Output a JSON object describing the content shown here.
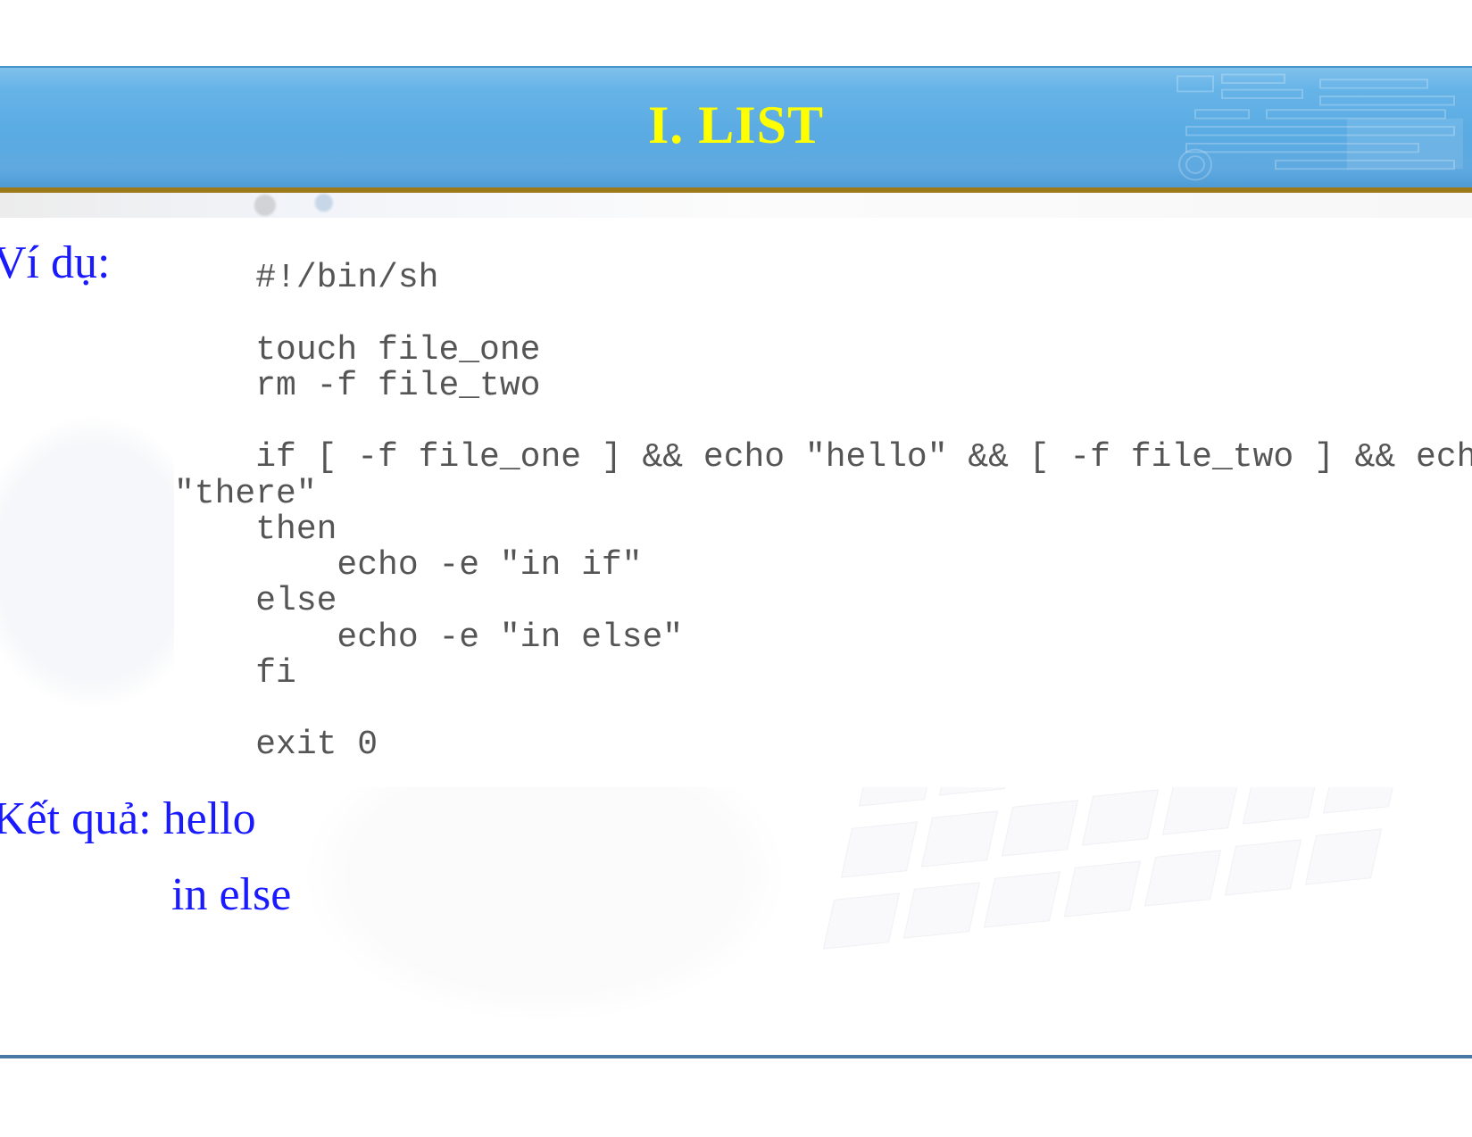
{
  "header": {
    "title": "I. LIST"
  },
  "labels": {
    "example": "Ví dụ:",
    "result_prefix": "Kết quả:",
    "result_line1": "hello",
    "result_line2": "in else"
  },
  "code": {
    "lines": [
      "#!/bin/sh",
      "",
      "touch file_one",
      "rm -f file_two",
      "",
      "if [ -f file_one ] && echo \"hello\" && [ -f file_two ] && echo \"there\"",
      "then",
      "    echo -e \"in if\"",
      "else",
      "    echo -e \"in else\"",
      "fi",
      "",
      "exit 0"
    ],
    "indent_cols": 4,
    "wrap_indent_cols": -2
  },
  "colors": {
    "title": "#ffff00",
    "label": "#1a1aff",
    "code": "#555555",
    "header_bg_top": "#7fc1ec",
    "header_bg_bottom": "#4e9bd6",
    "header_underline": "#9c7a1b",
    "footer_line": "#4a78a6"
  }
}
